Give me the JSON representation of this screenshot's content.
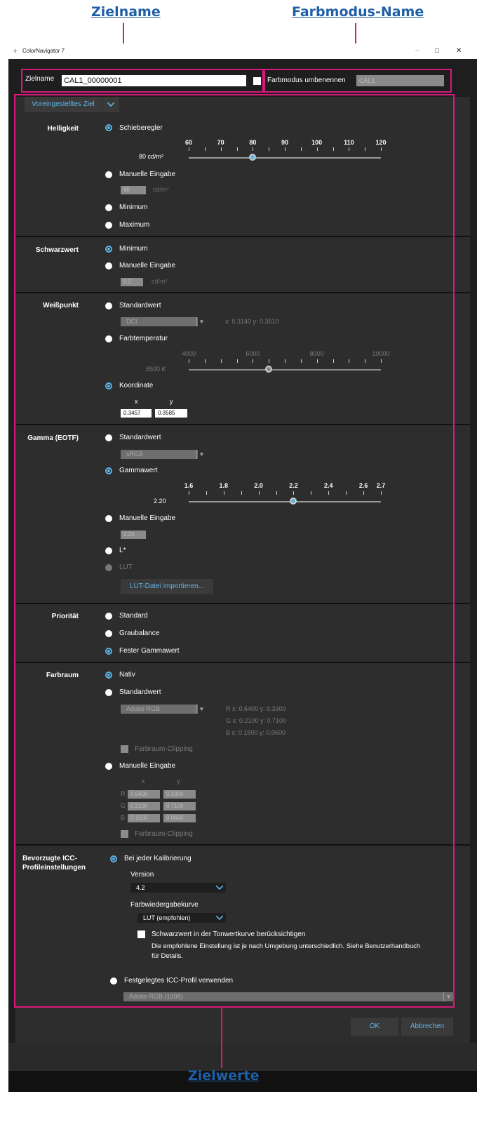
{
  "callouts": {
    "top_left": "Zielname",
    "top_right": "Farbmodus-Name",
    "bottom": "Zielwerte"
  },
  "window": {
    "title": "ColorNavigator 7",
    "controls": {
      "minimize": "–",
      "maximize": "□",
      "close": "✕"
    }
  },
  "header": {
    "zielname_label": "Zielname",
    "zielname_value": "CAL1_00000001",
    "farbmodus_label": "Farbmodus umbenennen",
    "farbmodus_value": "CAL1"
  },
  "preset": {
    "label": "Voreingestelltes Ziel"
  },
  "helligkeit": {
    "label": "Helligkeit",
    "opt_slider": "Schieberegler",
    "ticks": [
      "60",
      "70",
      "80",
      "90",
      "100",
      "110",
      "120"
    ],
    "slider_value": 80,
    "value_label": "80 cd/m²",
    "opt_manual": "Manuelle Eingabe",
    "manual_value": "80",
    "manual_unit": "cd/m²",
    "opt_min": "Minimum",
    "opt_max": "Maximum"
  },
  "schwarzwert": {
    "label": "Schwarzwert",
    "opt_min": "Minimum",
    "opt_manual": "Manuelle Eingabe",
    "manual_value": "0.2",
    "manual_unit": "cd/m²"
  },
  "weisspunkt": {
    "label": "Weißpunkt",
    "opt_standard": "Standardwert",
    "standard_value": "DCI",
    "standard_coords": "x: 0.3140  y: 0.3510",
    "opt_temp": "Farbtemperatur",
    "temp_ticks": [
      "4000",
      "6000",
      "8000",
      "10000"
    ],
    "temp_value": 6500,
    "temp_label": "6500 K",
    "opt_coord": "Koordinate",
    "x_label": "x",
    "y_label": "y",
    "x_value": "0.3457",
    "y_value": "0.3585"
  },
  "gamma": {
    "label": "Gamma (EOTF)",
    "opt_standard": "Standardwert",
    "standard_value": "sRGB",
    "opt_gamma": "Gammawert",
    "ticks": [
      "1.6",
      "1.8",
      "2.0",
      "2.2",
      "2.4",
      "2.6",
      "2.7"
    ],
    "slider_value": 2.2,
    "value_label": "2.20",
    "opt_manual": "Manuelle Eingabe",
    "manual_value": "2.20",
    "opt_lstar": "L*",
    "opt_lut": "LUT",
    "lut_button": "LUT-Datei importieren..."
  },
  "prioritaet": {
    "label": "Priorität",
    "opt_standard": "Standard",
    "opt_grau": "Graubalance",
    "opt_fest": "Fester Gammawert"
  },
  "farbraum": {
    "label": "Farbraum",
    "opt_nativ": "Nativ",
    "opt_standard": "Standardwert",
    "standard_value": "Adobe RGB",
    "coords": [
      "R  x: 0.6400   y: 0.3300",
      "G  x: 0.2100   y: 0.7100",
      "B  x: 0.1500   y: 0.0600"
    ],
    "clipping1": "Farbraum-Clipping",
    "opt_manual": "Manuelle Eingabe",
    "manual_x": "x",
    "manual_y": "y",
    "rows": [
      {
        "ch": "R",
        "x": "0.6400",
        "y": "0.3300"
      },
      {
        "ch": "G",
        "x": "0.2100",
        "y": "0.7100"
      },
      {
        "ch": "B",
        "x": "0.1500",
        "y": "0.0600"
      }
    ],
    "clipping2": "Farbraum-Clipping"
  },
  "icc": {
    "label_line1": "Bevorzugte ICC-",
    "label_line2": "Profileinstellungen",
    "opt_each": "Bei jeder Kalibrierung",
    "version_label": "Version",
    "version_value": "4.2",
    "curve_label": "Farbwiedergabekurve",
    "curve_value": "LUT (empfohlen)",
    "black_check": "Schwarzwert in der Tonwertkurve berücksichtigen",
    "note_line1": "Die empfohlene Einstellung ist je nach Umgebung unterschiedlich. Siehe Benutzerhandbuch",
    "note_line2": "für Details.",
    "opt_fixed": "Festgelegtes ICC-Profil verwenden",
    "fixed_value": "Adobe RGB (1998)"
  },
  "footer": {
    "ok": "OK",
    "cancel": "Abbrechen"
  },
  "colors": {
    "accent": "#5eb4e8",
    "callout": "#1f5fa8",
    "highlight": "#d6197a",
    "panel": "#2d2d2d"
  }
}
